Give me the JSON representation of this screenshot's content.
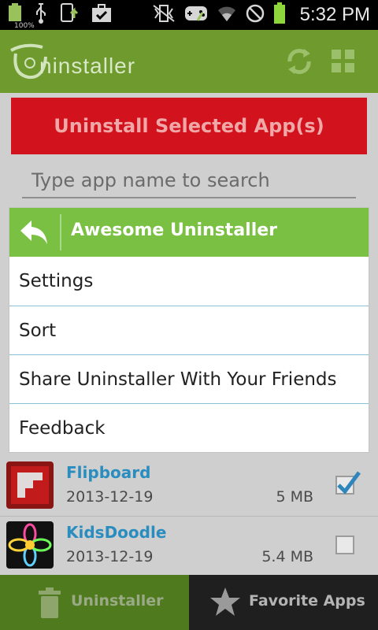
{
  "status_bar": {
    "battery_percent": "100%",
    "time": "5:32 PM"
  },
  "header": {
    "logo_text": "ninstaller",
    "icons": [
      "refresh-icon",
      "grid-icon"
    ]
  },
  "main": {
    "uninstall_button": "Uninstall Selected App(s)",
    "search_placeholder": "Type app name to search",
    "apps": [
      {
        "name": "Flipboard",
        "date": "2013-12-19",
        "size": "5 MB",
        "checked": true
      },
      {
        "name": "KidsDoodle",
        "date": "2013-12-19",
        "size": "5.4 MB",
        "checked": false
      }
    ]
  },
  "popup": {
    "title": "Awesome Uninstaller",
    "items": [
      "Settings",
      "Sort",
      "Share Uninstaller With Your Friends",
      "Feedback"
    ]
  },
  "tabs": {
    "uninstaller": "Uninstaller",
    "favorites": "Favorite Apps"
  },
  "colors": {
    "header_green": "#6e9a2e",
    "popup_green": "#7ac043",
    "uninstall_red": "#d2121d",
    "link_blue": "#2a8dbf"
  }
}
